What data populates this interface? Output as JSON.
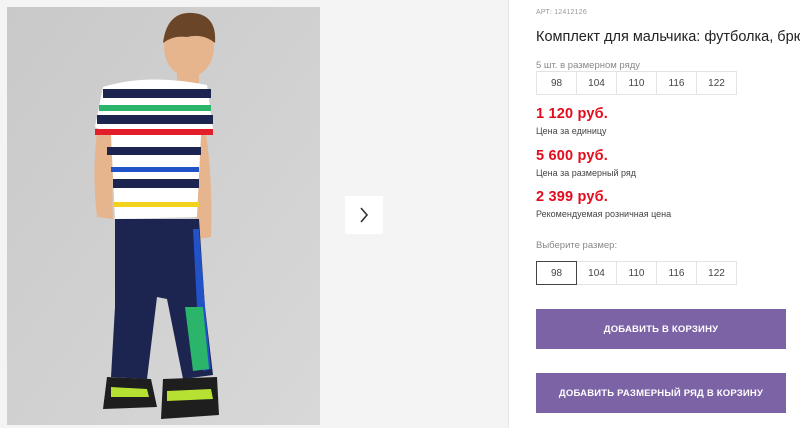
{
  "product": {
    "article_label": "АРТ: 12412126",
    "title": "Комплект для мальчика: футболка, брюки"
  },
  "series": {
    "caption": "5 шт. в размерном ряду",
    "sizes": [
      "98",
      "104",
      "110",
      "116",
      "122"
    ]
  },
  "prices": [
    {
      "value": "1 120 руб.",
      "label": "Цена за единицу"
    },
    {
      "value": "5 600 руб.",
      "label": "Цена за размерный ряд"
    },
    {
      "value": "2 399 руб.",
      "label": "Рекомендуемая розничная цена"
    }
  ],
  "size_select": {
    "caption": "Выберите размер:",
    "sizes": [
      "98",
      "104",
      "110",
      "116",
      "122"
    ],
    "selected": "98"
  },
  "buttons": {
    "add_to_cart": "Добавить в корзину",
    "add_series_to_cart": "Добавить размерный ряд в корзину"
  },
  "colors": {
    "price": "#e30b1c",
    "button": "#7c63a6"
  },
  "icons": {
    "next": "chevron-right-icon"
  }
}
